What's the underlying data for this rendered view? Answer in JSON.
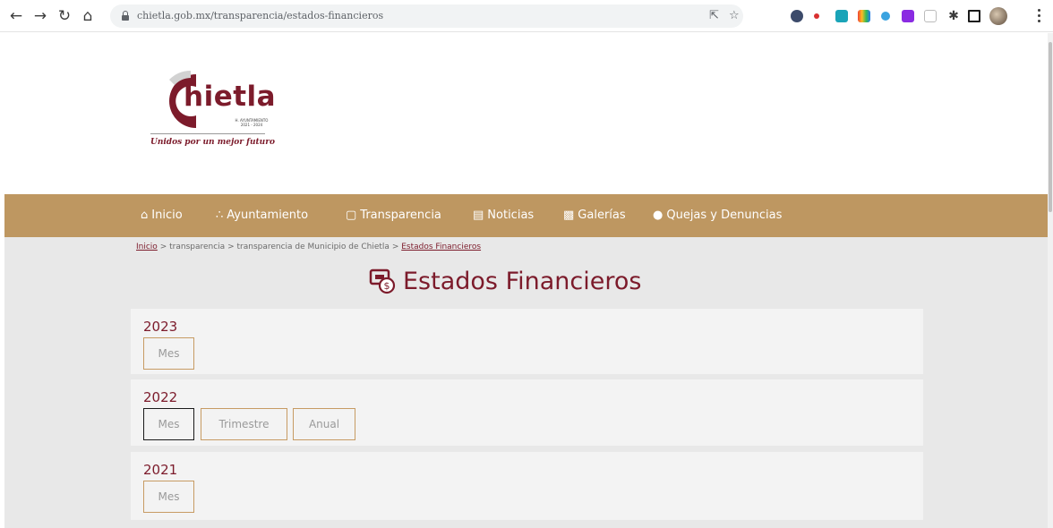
{
  "browser": {
    "url": "chietla.gob.mx/transparencia/estados-financieros",
    "back_icon": "arrow-left",
    "forward_icon": "arrow-right",
    "reload_icon": "reload",
    "home_icon": "home",
    "share_icon": "share",
    "bookmark_icon": "star"
  },
  "logo": {
    "word": "hietla",
    "sub_line1": "H. AYUNTAMIENTO",
    "sub_line2": "2021 - 2024",
    "slogan": "Unidos por un mejor futuro",
    "brand_color": "#7c1b2b"
  },
  "navbar": {
    "color": "#be9761",
    "items": [
      {
        "icon": "home-icon",
        "label": "Inicio"
      },
      {
        "icon": "sitemap-icon",
        "label": "Ayuntamiento"
      },
      {
        "icon": "document-icon",
        "label": "Transparencia"
      },
      {
        "icon": "newspaper-icon",
        "label": "Noticias"
      },
      {
        "icon": "images-icon",
        "label": "Galerías"
      },
      {
        "icon": "info-circle-icon",
        "label": "Quejas y Denuncias"
      }
    ]
  },
  "breadcrumb": {
    "items": [
      "Inicio",
      "transparencia",
      "transparencia de Municipio de Chietla",
      "Estados Financieros"
    ],
    "separator": ">"
  },
  "main": {
    "title": "Estados Financieros",
    "title_icon": "money-report-icon",
    "years": [
      {
        "year": "2023",
        "buttons": [
          {
            "label": "Mes",
            "active": false
          }
        ]
      },
      {
        "year": "2022",
        "buttons": [
          {
            "label": "Mes",
            "active": true
          },
          {
            "label": "Trimestre",
            "active": false
          },
          {
            "label": "Anual",
            "active": false
          }
        ]
      },
      {
        "year": "2021",
        "buttons": [
          {
            "label": "Mes",
            "active": false
          }
        ]
      }
    ]
  }
}
